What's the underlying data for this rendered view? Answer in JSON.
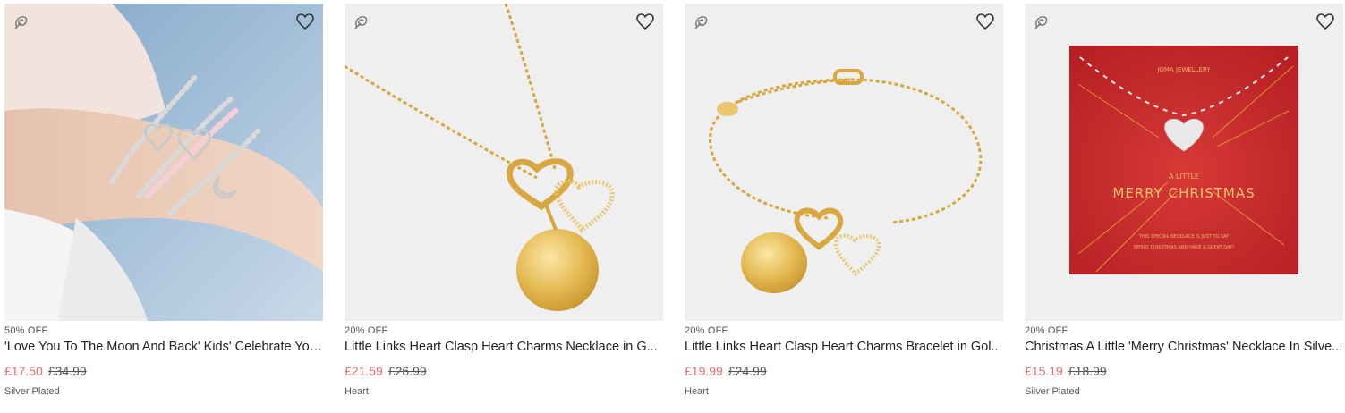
{
  "colors": {
    "sale": "#e0696a",
    "muted": "#555555",
    "card_bg": "#efefef",
    "xmas_red": "#c8262a"
  },
  "products": [
    {
      "image_icon": "bracelet-photo",
      "badge": "50% OFF",
      "title": "'Love You To The Moon And Back' Kids' Celebrate You...",
      "price_now": "£17.50",
      "price_was": "£34.99",
      "variant": "Silver Plated"
    },
    {
      "image_icon": "necklace-photo",
      "badge": "20% OFF",
      "title": "Little Links Heart Clasp Heart Charms Necklace in G...",
      "price_now": "£21.59",
      "price_was": "£26.99",
      "variant": "Heart"
    },
    {
      "image_icon": "bracelet-photo",
      "badge": "20% OFF",
      "title": "Little Links Heart Clasp Heart Charms Bracelet in Gol...",
      "price_now": "£19.99",
      "price_was": "£24.99",
      "variant": "Heart"
    },
    {
      "image_icon": "necklace-card-photo",
      "badge": "20% OFF",
      "title": "Christmas A Little 'Merry Christmas' Necklace In Silve...",
      "price_now": "£15.19",
      "price_was": "£18.99",
      "variant": "Silver Plated",
      "card_text": {
        "brand": "JOMA JEWELLERY",
        "small": "A LITTLE",
        "big": "MERRY CHRISTMAS",
        "line1": "THIS SPECIAL NECKLACE IS JUST TO SAY",
        "line2": "MERRY CHRISTMAS AND HAVE A GREAT DAY!"
      }
    }
  ]
}
